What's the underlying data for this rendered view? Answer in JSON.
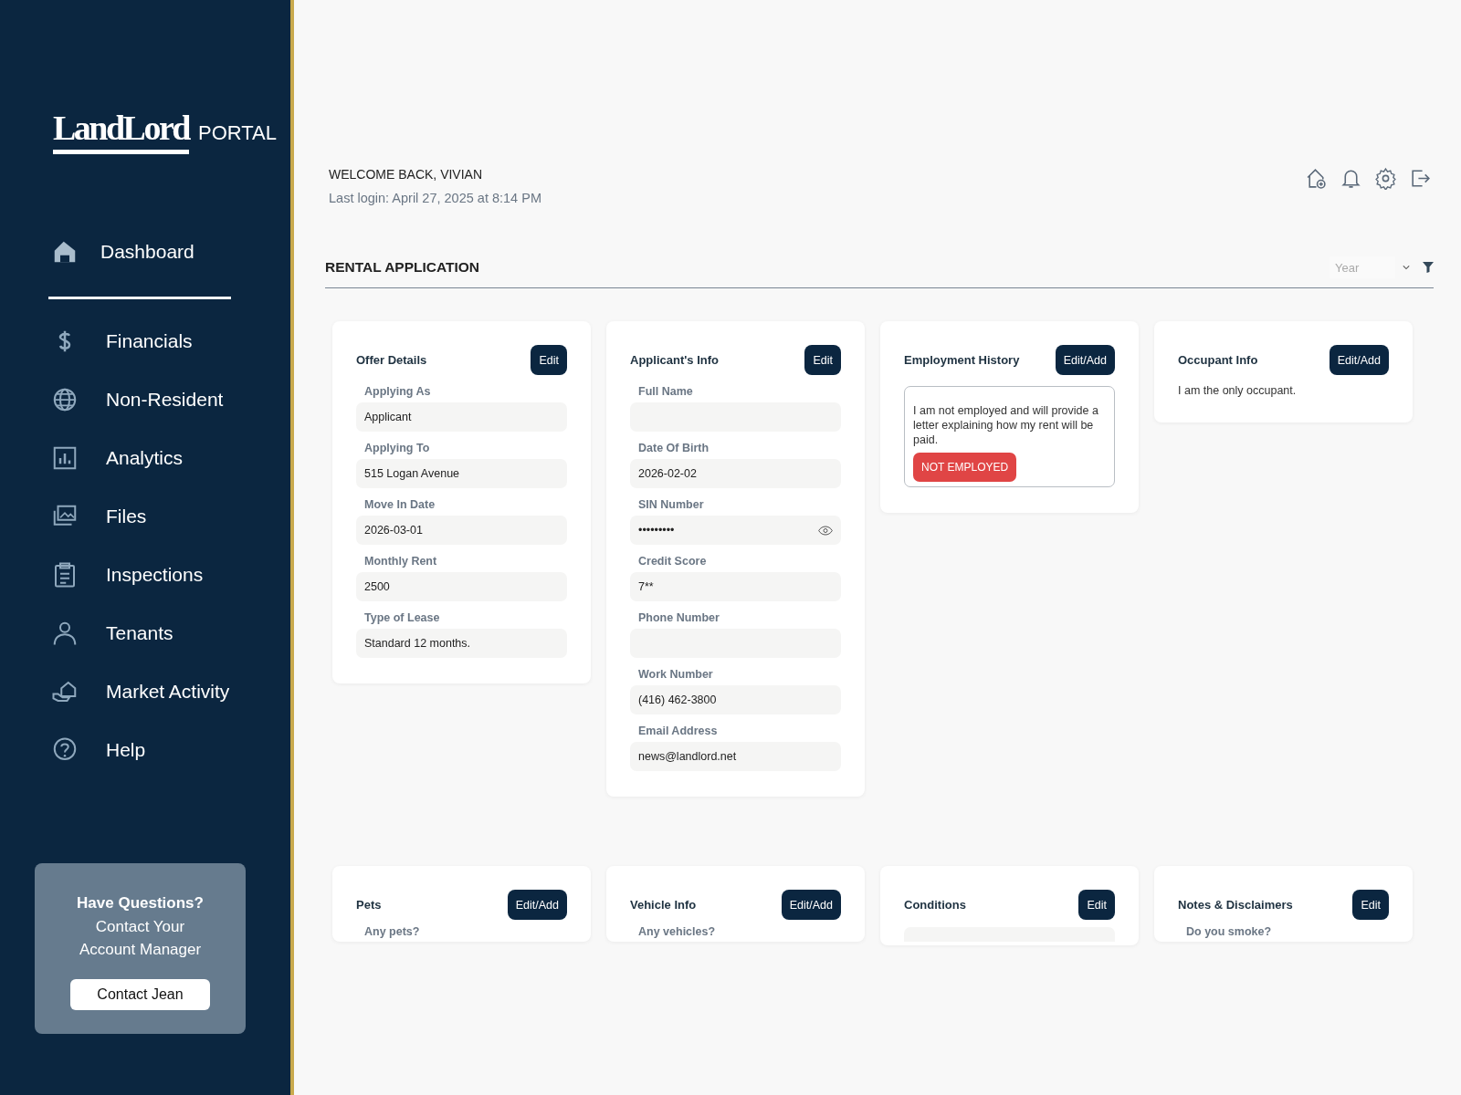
{
  "logo": {
    "wordmark": "LandLord",
    "suffix": "PORTAL"
  },
  "nav": [
    {
      "label": "Dashboard",
      "selected": true
    },
    {
      "label": "Financials",
      "selected": false
    },
    {
      "label": "Non-Resident",
      "selected": false
    },
    {
      "label": "Analytics",
      "selected": false
    },
    {
      "label": "Files",
      "selected": false
    },
    {
      "label": "Inspections",
      "selected": false
    },
    {
      "label": "Tenants",
      "selected": false
    },
    {
      "label": "Market Activity",
      "selected": false
    },
    {
      "label": "Help",
      "selected": false
    }
  ],
  "contact": {
    "title": "Have Questions?",
    "text": "Contact Your Account Manager",
    "button": "Contact Jean"
  },
  "header": {
    "welcome": "WELCOME BACK, VIVIAN",
    "last_login": "Last login: April 27, 2025 at 8:14 PM"
  },
  "section": {
    "title": "RENTAL APPLICATION",
    "filter_placeholder": "Year"
  },
  "cards": [
    {
      "title": "Offer Details",
      "button": "Edit",
      "kind": "fields",
      "fields": [
        {
          "label": "Applying As",
          "value": "Applicant"
        },
        {
          "label": "Applying To",
          "value": "515 Logan Avenue"
        },
        {
          "label": "Move In Date",
          "value": "2026-03-01"
        },
        {
          "label": "Monthly Rent",
          "value": "2500"
        },
        {
          "label": "Type of Lease",
          "value": "Standard 12 months."
        }
      ]
    },
    {
      "title": "Applicant's Info",
      "button": "Edit",
      "kind": "fields",
      "fields": [
        {
          "label": "Full Name"
        },
        {
          "label": "Date Of Birth",
          "value": "2026-02-02"
        },
        {
          "label": "SIN Number",
          "value": "•••••••••",
          "secret": true
        },
        {
          "label": "Credit Score",
          "value": "7**"
        },
        {
          "label": "Phone Number"
        },
        {
          "label": "Work Number",
          "value": "(416) 462-3800"
        },
        {
          "label": "Email Address",
          "value": "news@landlord.net"
        }
      ]
    },
    {
      "title": "Employment History",
      "button": "Edit/Add",
      "kind": "note",
      "text": "I am not employed and will provide a letter explaining how my rent will be paid.",
      "badge": "NOT EMPLOYED"
    },
    {
      "title": "Occupant Info",
      "button": "Edit/Add",
      "kind": "text",
      "text": "I am the only occupant."
    }
  ],
  "cards_row2": [
    {
      "title": "Pets",
      "button": "Edit/Add",
      "kind": "text",
      "text": "Any pets?"
    },
    {
      "title": "Vehicle Info",
      "button": "Edit/Add",
      "kind": "text",
      "text": "Any vehicles?"
    },
    {
      "title": "Conditions",
      "button": "Edit",
      "kind": "field"
    },
    {
      "title": "Notes & Disclaimers",
      "button": "Edit",
      "kind": "text",
      "text": "Do you smoke?"
    }
  ]
}
